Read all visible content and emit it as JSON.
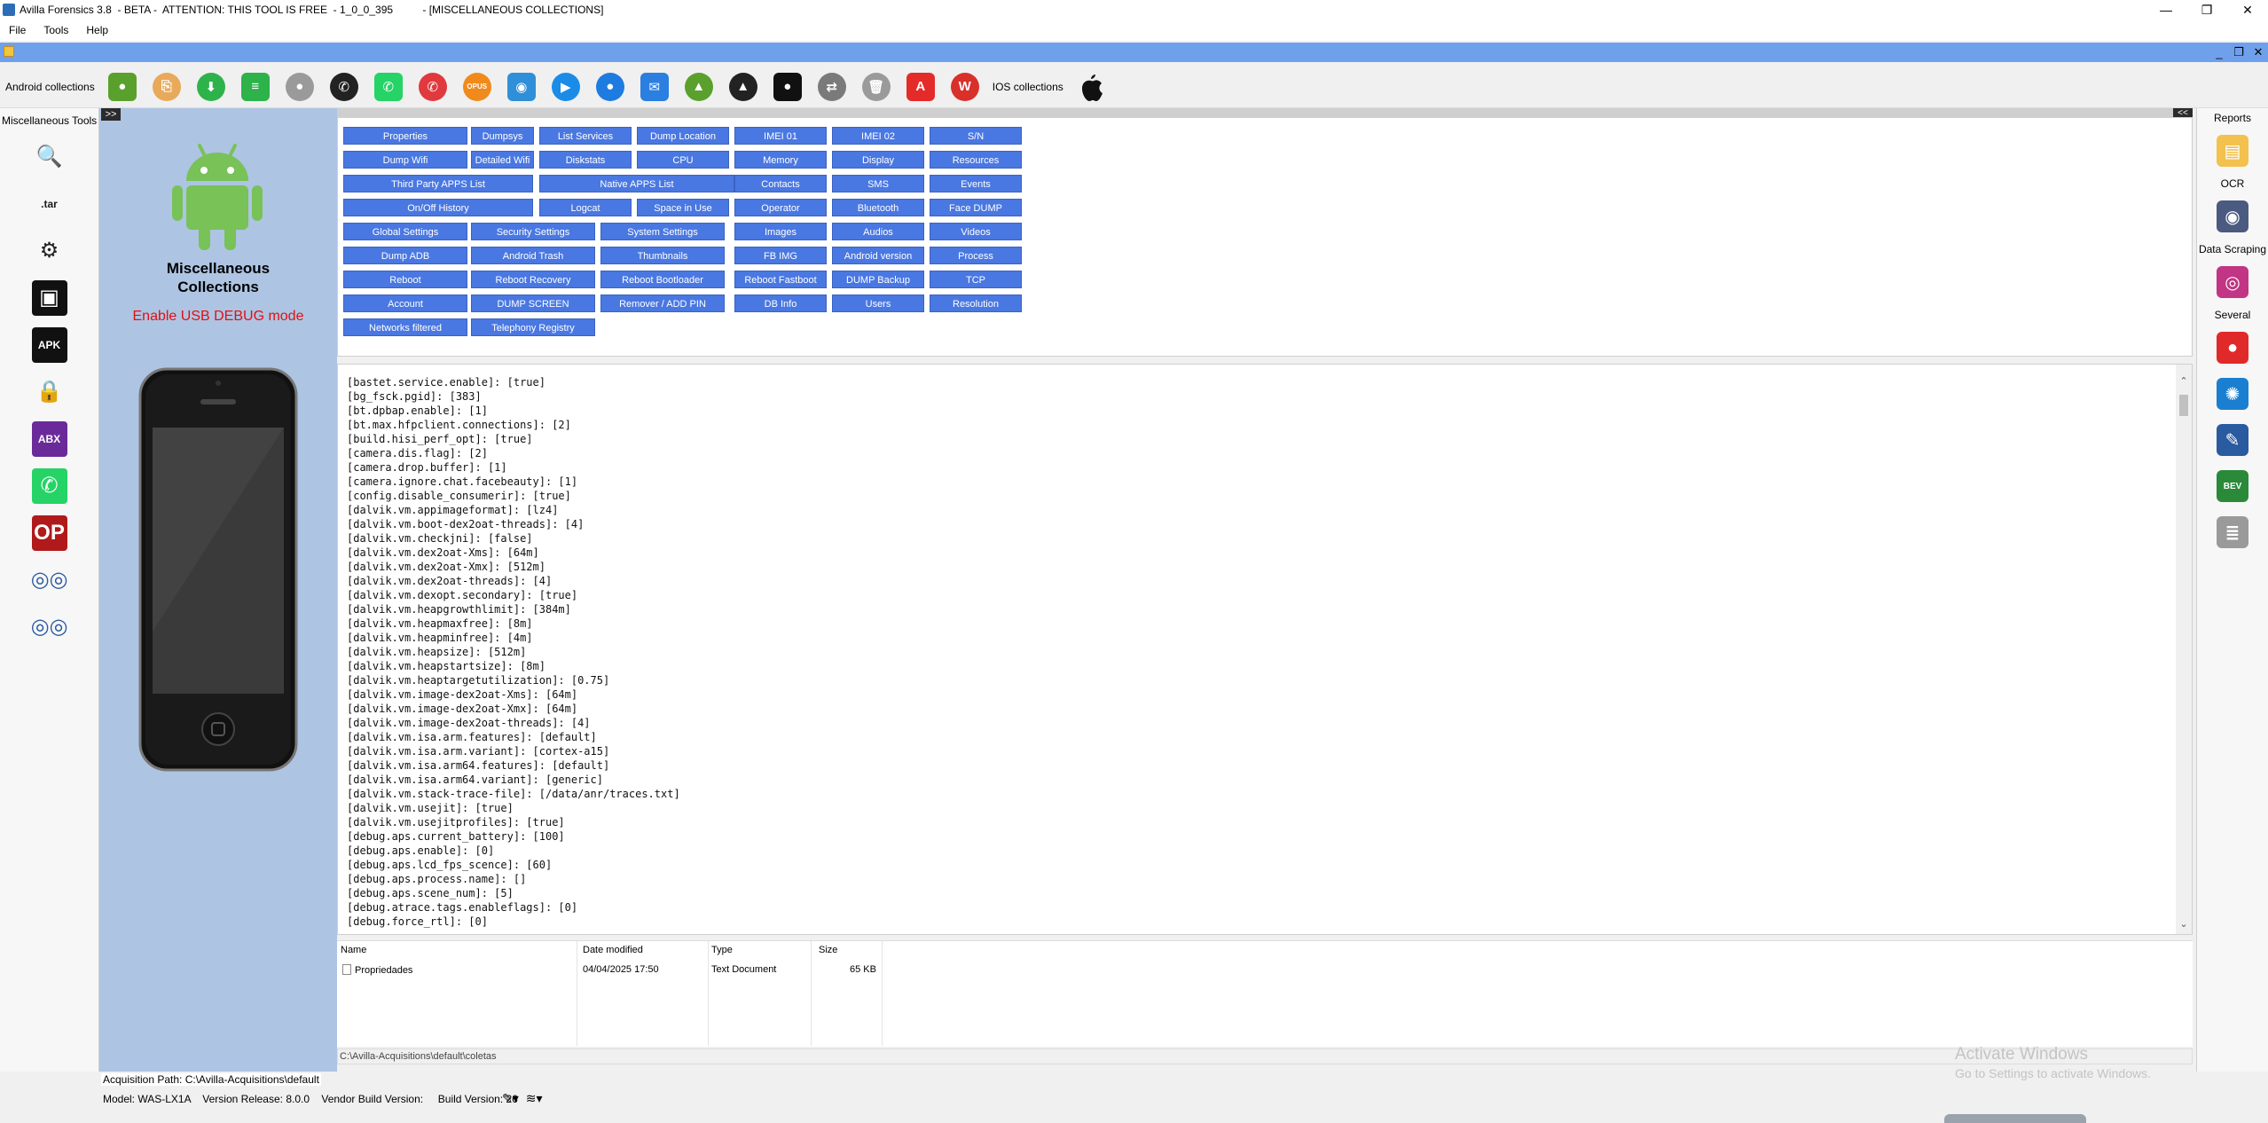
{
  "window": {
    "title": "Avilla Forensics 3.8  - BETA -  ATTENTION: THIS TOOL IS FREE  - 1_0_0_395          - [MISCELLANEOUS COLLECTIONS]",
    "minimize_glyph": "—",
    "maximize_glyph": "❐",
    "close_glyph": "✕",
    "mdi_minimize_glyph": "_",
    "mdi_restore_glyph": "❐",
    "mdi_close_glyph": "✕"
  },
  "menu": {
    "file": "File",
    "tools": "Tools",
    "help": "Help"
  },
  "toolbar": {
    "android_label": "Android collections",
    "ios_label": "IOS collections",
    "icons": [
      {
        "name": "android-green-icon",
        "glyph": "●",
        "color": "#5aa02c"
      },
      {
        "name": "collect-icon",
        "glyph": "⎘",
        "color": "#e8a95a"
      },
      {
        "name": "download-icon",
        "glyph": "⬇",
        "color": "#2db34a"
      },
      {
        "name": "database-green-icon",
        "glyph": "≡",
        "color": "#2db34a"
      },
      {
        "name": "user-gray-icon",
        "glyph": "●",
        "color": "#9a9a9a"
      },
      {
        "name": "whatsapp-black-icon",
        "glyph": "✆",
        "color": "#222222"
      },
      {
        "name": "whatsapp-icon",
        "glyph": "✆",
        "color": "#25d366"
      },
      {
        "name": "phone-icon",
        "glyph": "✆",
        "color": "#e0393e"
      },
      {
        "name": "opus-icon",
        "glyph": "OPUS",
        "color": "#f08a1c"
      },
      {
        "name": "camera-icon",
        "glyph": "◉",
        "color": "#2f8fd8"
      },
      {
        "name": "video-icon",
        "glyph": "▶",
        "color": "#1a8ce8"
      },
      {
        "name": "contacts-icon",
        "glyph": "●",
        "color": "#1e7be0"
      },
      {
        "name": "message-icon",
        "glyph": "✉",
        "color": "#2a7fe0"
      },
      {
        "name": "android-robot-icon",
        "glyph": "▲",
        "color": "#5aa02c"
      },
      {
        "name": "android-dark-icon",
        "glyph": "▲",
        "color": "#222222"
      },
      {
        "name": "chat-icon",
        "glyph": "●",
        "color": "#111111"
      },
      {
        "name": "transfer-icon",
        "glyph": "⇄",
        "color": "#7a7a7a"
      },
      {
        "name": "trash-icon",
        "glyph": "🗑",
        "color": "#9a9a9a"
      },
      {
        "name": "acrobat-icon",
        "glyph": "A",
        "color": "#e52a2a"
      },
      {
        "name": "winrar-icon",
        "glyph": "W",
        "color": "#d9302a"
      }
    ]
  },
  "left_tools": {
    "header": "Miscellaneous Tools",
    "items": [
      {
        "name": "magnifier-icon",
        "glyph": "🔍",
        "color": "#1a6fd0",
        "bg": "transparent"
      },
      {
        "name": "tar-icon",
        "glyph": ".tar",
        "color": "#1a1a1a",
        "bg": "transparent"
      },
      {
        "name": "gear-search-icon",
        "glyph": "⚙",
        "color": "#222222",
        "bg": "transparent"
      },
      {
        "name": "image-icon",
        "glyph": "▣",
        "color": "#ffffff",
        "bg": "#111111"
      },
      {
        "name": "apk-icon",
        "glyph": "APK",
        "color": "#ffffff",
        "bg": "#111111"
      },
      {
        "name": "lock-jpg-icon",
        "glyph": "🔒",
        "color": "#d9a21a",
        "bg": "transparent"
      },
      {
        "name": "abx-icon",
        "glyph": "ABX",
        "color": "#ffffff",
        "bg": "#6b2a9a"
      },
      {
        "name": "whatsapp-tool-icon",
        "glyph": "✆",
        "color": "#ffffff",
        "bg": "#25d366"
      },
      {
        "name": "opcode-icon",
        "glyph": "OP",
        "color": "#ffffff",
        "bg": "#b01a1a"
      },
      {
        "name": "spy-icon",
        "glyph": "◎◎",
        "color": "#2a5aa0",
        "bg": "transparent"
      },
      {
        "name": "spy2-icon",
        "glyph": "◎◎",
        "color": "#2a5aa0",
        "bg": "transparent"
      }
    ]
  },
  "panel": {
    "toggle": ">>",
    "title_line1": "Miscellaneous",
    "title_line2": "Collections",
    "warning": "Enable USB DEBUG mode"
  },
  "buttons": [
    {
      "label": "Properties",
      "col": 0
    },
    {
      "label": "Dumpsys",
      "col": 1
    },
    {
      "label": "List Services",
      "col": 2
    },
    {
      "label": "Dump Location",
      "col": 3
    },
    {
      "label": "IMEI 01",
      "col": 4
    },
    {
      "label": "IMEI 02",
      "col": 5
    },
    {
      "label": "S/N",
      "col": 6
    },
    {
      "label": "Dump Wifi",
      "col": 0
    },
    {
      "label": "Detailed Wifi",
      "col": 1
    },
    {
      "label": "Diskstats",
      "col": 2
    },
    {
      "label": "CPU",
      "col": 3
    },
    {
      "label": "Memory",
      "col": 4
    },
    {
      "label": "Display",
      "col": 5
    },
    {
      "label": "Resources",
      "col": 6
    },
    {
      "label": "Third Party APPS List",
      "col": 0
    },
    {
      "label": "Native APPS List",
      "col": 2
    },
    {
      "label": "Contacts",
      "col": 4
    },
    {
      "label": "SMS",
      "col": 5
    },
    {
      "label": "Events",
      "col": 6
    },
    {
      "label": "On/Off History",
      "col": 0
    },
    {
      "label": "Logcat",
      "col": 2
    },
    {
      "label": "Space in Use",
      "col": 3
    },
    {
      "label": "Operator",
      "col": 4
    },
    {
      "label": "Bluetooth",
      "col": 5
    },
    {
      "label": "Face DUMP",
      "col": 6
    },
    {
      "label": "Global Settings",
      "col": 0
    },
    {
      "label": "Security Settings",
      "col": 1
    },
    {
      "label": "System Settings",
      "col": 2
    },
    {
      "label": "Images",
      "col": 4
    },
    {
      "label": "Audios",
      "col": 5
    },
    {
      "label": "Videos",
      "col": 6
    },
    {
      "label": "Dump ADB",
      "col": 0
    },
    {
      "label": "Android Trash",
      "col": 1
    },
    {
      "label": "Thumbnails",
      "col": 3
    },
    {
      "label": "FB  IMG",
      "col": 4
    },
    {
      "label": "Android version",
      "col": 5
    },
    {
      "label": "Process",
      "col": 6
    },
    {
      "label": "Reboot",
      "col": 0
    },
    {
      "label": "Reboot Recovery",
      "col": 1
    },
    {
      "label": "Reboot Bootloader",
      "col": 3
    },
    {
      "label": "Reboot Fastboot",
      "col": 4
    },
    {
      "label": "DUMP Backup",
      "col": 5
    },
    {
      "label": "TCP",
      "col": 6
    },
    {
      "label": "Account",
      "col": 0
    },
    {
      "label": "DUMP SCREEN",
      "col": 1
    },
    {
      "label": "Remover / ADD PIN",
      "col": 3
    },
    {
      "label": "DB Info",
      "col": 4
    },
    {
      "label": "Users",
      "col": 5
    },
    {
      "label": "Resolution",
      "col": 6
    },
    {
      "label": "Networks filtered",
      "col": 0
    },
    {
      "label": "Telephony Registry",
      "col": 1
    }
  ],
  "output": {
    "lines": [
      "[bastet.service.enable]: [true]",
      "[bg_fsck.pgid]: [383]",
      "[bt.dpbap.enable]: [1]",
      "[bt.max.hfpclient.connections]: [2]",
      "[build.hisi_perf_opt]: [true]",
      "[camera.dis.flag]: [2]",
      "[camera.drop.buffer]: [1]",
      "[camera.ignore.chat.facebeauty]: [1]",
      "[config.disable_consumerir]: [true]",
      "[dalvik.vm.appimageformat]: [lz4]",
      "[dalvik.vm.boot-dex2oat-threads]: [4]",
      "[dalvik.vm.checkjni]: [false]",
      "[dalvik.vm.dex2oat-Xms]: [64m]",
      "[dalvik.vm.dex2oat-Xmx]: [512m]",
      "[dalvik.vm.dex2oat-threads]: [4]",
      "[dalvik.vm.dexopt.secondary]: [true]",
      "[dalvik.vm.heapgrowthlimit]: [384m]",
      "[dalvik.vm.heapmaxfree]: [8m]",
      "[dalvik.vm.heapminfree]: [4m]",
      "[dalvik.vm.heapsize]: [512m]",
      "[dalvik.vm.heapstartsize]: [8m]",
      "[dalvik.vm.heaptargetutilization]: [0.75]",
      "[dalvik.vm.image-dex2oat-Xms]: [64m]",
      "[dalvik.vm.image-dex2oat-Xmx]: [64m]",
      "[dalvik.vm.image-dex2oat-threads]: [4]",
      "[dalvik.vm.isa.arm.features]: [default]",
      "[dalvik.vm.isa.arm.variant]: [cortex-a15]",
      "[dalvik.vm.isa.arm64.features]: [default]",
      "[dalvik.vm.isa.arm64.variant]: [generic]",
      "[dalvik.vm.stack-trace-file]: [/data/anr/traces.txt]",
      "[dalvik.vm.usejit]: [true]",
      "[dalvik.vm.usejitprofiles]: [true]",
      "[debug.aps.current_battery]: [100]",
      "[debug.aps.enable]: [0]",
      "[debug.aps.lcd_fps_scence]: [60]",
      "[debug.aps.process.name]: []",
      "[debug.aps.scene_num]: [5]",
      "[debug.atrace.tags.enableflags]: [0]",
      "[debug.force_rtl]: [0]"
    ]
  },
  "filelist": {
    "col_name": "Name",
    "col_date": "Date modified",
    "col_type": "Type",
    "col_size": "Size",
    "rows": [
      {
        "name": "Propriedades",
        "date": "04/04/2025 17:50",
        "type": "Text Document",
        "size": "65 KB"
      }
    ]
  },
  "pathbar": "C:\\Avilla-Acquisitions\\default\\coletas",
  "rightcol": {
    "reports": "Reports",
    "ocr": "OCR",
    "scraping": "Data Scraping",
    "several": "Several",
    "icons": [
      {
        "name": "reports-icon",
        "glyph": "▤",
        "color": "#f2c14e"
      },
      {
        "name": "ocr-icon",
        "glyph": "◉",
        "color": "#4a5a80"
      },
      {
        "name": "instagram-icon",
        "glyph": "◎",
        "color": "#c13584"
      },
      {
        "name": "map-pin-icon",
        "glyph": "●",
        "color": "#e02a2a"
      },
      {
        "name": "network-gear-icon",
        "glyph": "✺",
        "color": "#1a7fd0"
      },
      {
        "name": "tools-icon",
        "glyph": "✎",
        "color": "#2a5aa0"
      },
      {
        "name": "bev-icon",
        "glyph": "BEV",
        "color": "#2a8a3a"
      },
      {
        "name": "database-icon",
        "glyph": "≣",
        "color": "#9a9a9a"
      }
    ]
  },
  "status": {
    "acquisition_path": "Acquisition Path: C:\\Avilla-Acquisitions\\default",
    "info": "Model: WAS-LX1A    Version Release: 8.0.0    Vendor Build Version:     Build Version: 26",
    "icon_pen": "✎▾",
    "icon_wifi": "≋▾"
  },
  "watermark": {
    "line1": "Activate Windows",
    "line2": "Go to Settings to activate Windows."
  }
}
